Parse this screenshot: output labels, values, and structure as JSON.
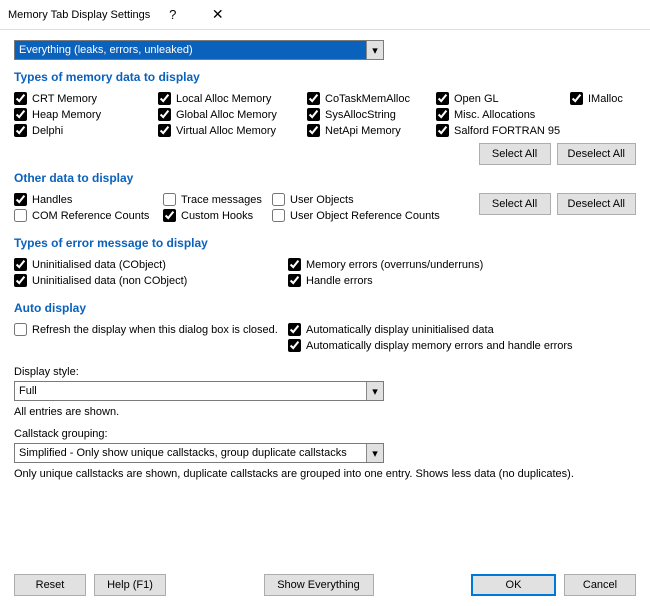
{
  "window": {
    "title": "Memory Tab Display Settings",
    "help_glyph": "?",
    "close_glyph": "✕"
  },
  "filter_combo": {
    "value": "Everything (leaks, errors, unleaked)",
    "arrow": "▾"
  },
  "sections": {
    "types": {
      "title": "Types of memory data to display",
      "r1": {
        "c1": "CRT Memory",
        "c2": "Local Alloc Memory",
        "c3": "CoTaskMemAlloc",
        "c4": "Open GL",
        "c5": "IMalloc"
      },
      "r2": {
        "c1": "Heap Memory",
        "c2": "Global Alloc Memory",
        "c3": "SysAllocString",
        "c4": "Misc. Allocations"
      },
      "r3": {
        "c1": "Delphi",
        "c2": "Virtual Alloc Memory",
        "c3": "NetApi Memory",
        "c4": "Salford FORTRAN 95"
      },
      "select_all": "Select All",
      "deselect_all": "Deselect All"
    },
    "other": {
      "title": "Other data to display",
      "r1": {
        "c1": "Handles",
        "c2": "Trace messages",
        "c3": "User Objects"
      },
      "r2": {
        "c1": "COM Reference Counts",
        "c2": "Custom Hooks",
        "c3": "User Object Reference Counts"
      },
      "select_all": "Select All",
      "deselect_all": "Deselect All"
    },
    "errors": {
      "title": "Types of error message to display",
      "r1": {
        "c1": "Uninitialised data (CObject)",
        "c2": "Memory errors (overruns/underruns)"
      },
      "r2": {
        "c1": "Uninitialised data (non CObject)",
        "c2": "Handle errors"
      }
    },
    "auto": {
      "title": "Auto display",
      "refresh": "Refresh the display when this dialog box is closed.",
      "a1": "Automatically display uninitialised data",
      "a2": "Automatically display memory errors and handle errors"
    }
  },
  "display_style": {
    "label": "Display style:",
    "value": "Full",
    "helper": "All entries are shown.",
    "arrow": "▾"
  },
  "callstack": {
    "label": "Callstack grouping:",
    "value": "Simplified - Only show unique callstacks, group duplicate callstacks",
    "helper": "Only unique callstacks are shown, duplicate callstacks are grouped into one entry. Shows less data (no duplicates).",
    "arrow": "▾"
  },
  "buttons": {
    "reset": "Reset",
    "help": "Help (F1)",
    "show_everything": "Show Everything",
    "ok": "OK",
    "cancel": "Cancel"
  }
}
